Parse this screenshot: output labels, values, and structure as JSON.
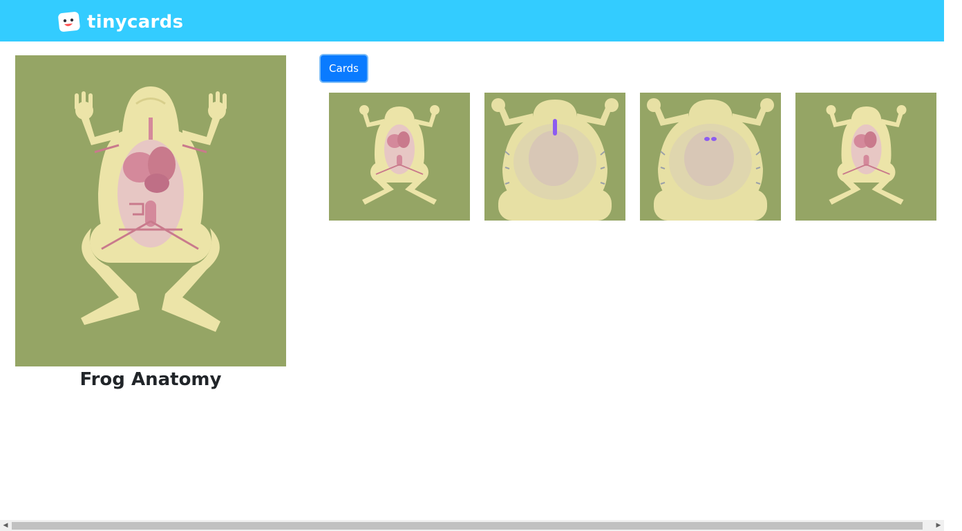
{
  "header": {
    "brand": "tinycards",
    "brand_color": "#33ccff"
  },
  "deck": {
    "title": "Frog Anatomy",
    "cover_icon": "frog-anatomy-illustration"
  },
  "toolbar": {
    "cards_label": "Cards",
    "cards_color": "#0a7bff"
  },
  "cards": [
    {
      "icon": "frog-anatomy-card-image"
    },
    {
      "icon": "frog-skeleton-card-image"
    },
    {
      "icon": "frog-eyes-card-image"
    },
    {
      "icon": "frog-anatomy-card-image"
    }
  ],
  "colors": {
    "card_background": "#95a565",
    "frog_body": "#ece4a8",
    "organ": "#d4899b"
  }
}
